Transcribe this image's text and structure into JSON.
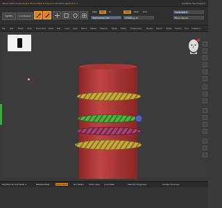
{
  "titlebar": {
    "title": "ZBrush 2019 ▸ Sculpt Mode ▸ Torus ▸ Stitch ▸ Polycount: 557,984 ▸ MeshCount: 5",
    "right_text": "QuickSave   See-through 0"
  },
  "toolbar": {
    "lightbox": "LightBox",
    "live_boolean": "Live Boolean",
    "mrgb": "Mrgb",
    "rgb": "Rgb",
    "m": "M",
    "zadd": "Zadd",
    "zsub": "Zsub",
    "zcut": "Zcut",
    "rgb_intensity": "Rgb Intensity 100",
    "z_intensity": "Z Intensity 25",
    "focal_shift": "Focal Shift 0",
    "draw_size": "Draw Size 64",
    "rgb_intensity_value": 100,
    "z_intensity_value": 25,
    "focal_shift_value": 0,
    "draw_size_value": 64
  },
  "menu": [
    "File",
    "Edit",
    "Brush",
    "Color",
    "Document",
    "Draw",
    "Edit",
    "Layer",
    "Light",
    "Macro",
    "Marker",
    "Material",
    "Movie",
    "Picker",
    "Preferences",
    "Render",
    "Stencil",
    "Stroke",
    "Texture",
    "Tool",
    "Transform",
    "Zplugin",
    "Zscript"
  ],
  "viewport": {
    "head_icon": "head-navigation-icon",
    "colors": {
      "cylinder": "#b93a3a",
      "torus_gold": "#c7a83a",
      "torus_green": "#4fae3f",
      "torus_magenta": "#a13d6a",
      "sphere_blue": "#5a5fb3"
    }
  },
  "statusbar": {
    "item1": "Weighted Smooth Mode 4",
    "item2": "BackfaceMask",
    "item3": "Deformation",
    "item4": "Del Hidden",
    "item5": "Close Holes",
    "item6": "Loop Mask",
    "item7": "Mesh By Polygroups",
    "item8": "Activate Symmetry"
  }
}
